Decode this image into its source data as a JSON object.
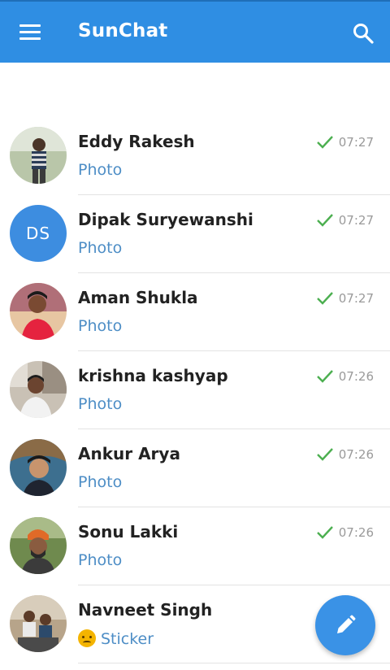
{
  "app": {
    "title": "SunChat",
    "colors": {
      "toolbar": "#2f8ee3",
      "accent": "#3a92e6",
      "preview": "#4e8ec6",
      "check": "#4caf50"
    }
  },
  "toolbar": {
    "menu_icon": "hamburger-menu-icon",
    "search_icon": "search-icon"
  },
  "chats": [
    {
      "name": "Eddy Rakesh",
      "preview": "Photo",
      "time": "07:27",
      "read": true,
      "avatar": "photo"
    },
    {
      "name": "Dipak Suryewanshi",
      "preview": "Photo",
      "time": "07:27",
      "read": true,
      "avatar": "initials",
      "initials": "DS"
    },
    {
      "name": "Aman Shukla",
      "preview": "Photo",
      "time": "07:27",
      "read": true,
      "avatar": "photo"
    },
    {
      "name": "krishna kashyap",
      "preview": "Photo",
      "time": "07:26",
      "read": true,
      "avatar": "photo"
    },
    {
      "name": "Ankur Arya",
      "preview": "Photo",
      "time": "07:26",
      "read": true,
      "avatar": "photo"
    },
    {
      "name": "Sonu Lakki",
      "preview": "Photo",
      "time": "07:26",
      "read": true,
      "avatar": "photo"
    },
    {
      "name": "Navneet Singh",
      "preview": "Sticker",
      "preview_emoji": "angry-face-emoji",
      "avatar": "photo"
    }
  ],
  "fab": {
    "icon": "pencil-icon"
  }
}
